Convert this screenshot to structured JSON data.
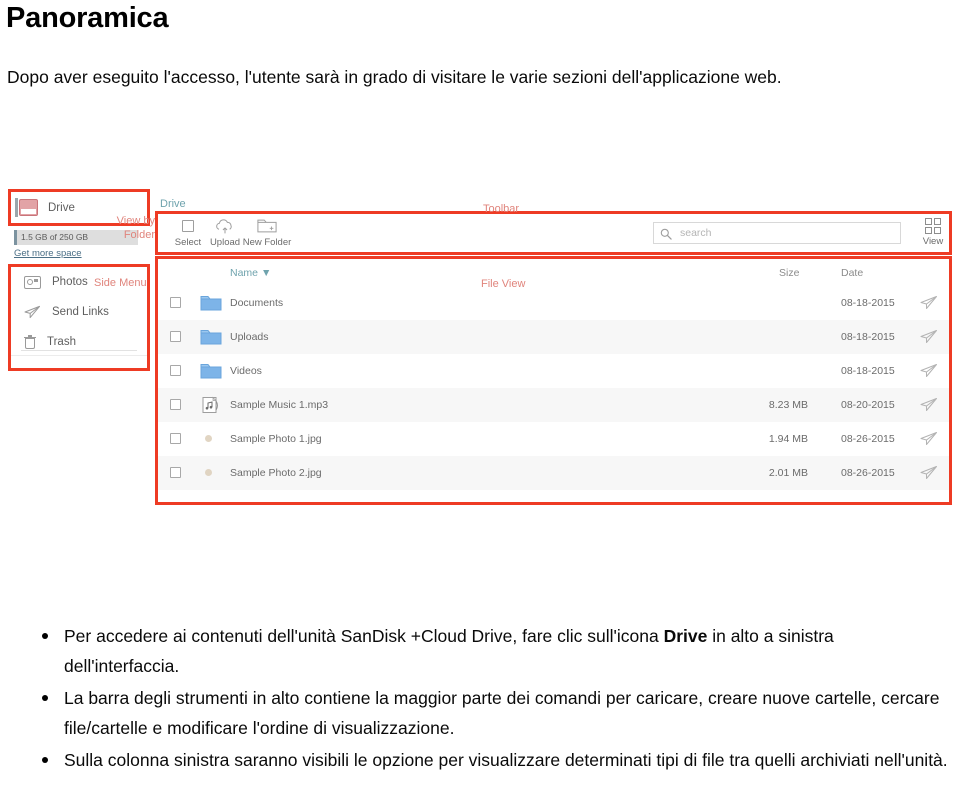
{
  "document": {
    "title": "Panoramica",
    "intro": "Dopo aver eseguito l'accesso, l'utente sarà in grado di visitare le varie sezioni dell'applicazione web.",
    "bullets": [
      {
        "pre": "Per accedere ai contenuti dell'unità SanDisk +Cloud Drive, fare clic sull'icona ",
        "bold": "Drive",
        "post": " in alto a sinistra dell'interfaccia."
      },
      {
        "pre": "La barra degli strumenti in alto contiene la maggior parte dei comandi per caricare, creare nuove cartelle, cercare file/cartelle e modificare l'ordine di visualizzazione.",
        "bold": "",
        "post": ""
      },
      {
        "pre": "Sulla colonna sinistra saranno visibili le opzione per visualizzare determinati tipi di file tra quelli archiviati nell'unità.",
        "bold": "",
        "post": ""
      }
    ]
  },
  "annotations": {
    "view_by_folder": "View by\nFolder",
    "view_by_folder_l1": "View by",
    "view_by_folder_l2": "Folder",
    "side_menu": "Side Menu",
    "toolbar": "Toolbar",
    "file_view": "File View",
    "box_color": "#ee3b24",
    "label_color": "#e0847c"
  },
  "app": {
    "sidebar": {
      "drive": {
        "label": "Drive",
        "icon": "drive-icon"
      },
      "storage": {
        "text": "1.5 GB of 250 GB",
        "used_gb": 1.5,
        "total_gb": 250,
        "percent": 0.6
      },
      "get_more_space": "Get more space",
      "menu_items": [
        {
          "label": "Photos",
          "icon": "camera-icon"
        },
        {
          "label": "Send Links",
          "icon": "paper-plane-icon"
        },
        {
          "label": "Trash",
          "icon": "trash-icon"
        }
      ]
    },
    "breadcrumb": "Drive",
    "toolbar": {
      "buttons": [
        {
          "label": "Select",
          "icon": "checkbox-icon"
        },
        {
          "label": "Upload",
          "icon": "cloud-upload-icon"
        },
        {
          "label": "New Folder",
          "icon": "new-folder-icon"
        }
      ],
      "search": {
        "placeholder": "search",
        "value": "",
        "icon": "search-icon"
      },
      "view": {
        "label": "View",
        "icon": "grid-view-icon"
      }
    },
    "file_view": {
      "columns": {
        "name": "Name",
        "sort_glyph": "▼",
        "size": "Size",
        "date": "Date"
      },
      "rows": [
        {
          "name": "Documents",
          "icon": "folder-icon",
          "size": "",
          "date": "08-18-2015"
        },
        {
          "name": "Uploads",
          "icon": "folder-icon",
          "size": "",
          "date": "08-18-2015"
        },
        {
          "name": "Videos",
          "icon": "folder-icon",
          "size": "",
          "date": "08-18-2015"
        },
        {
          "name": "Sample Music 1.mp3",
          "icon": "music-file-icon",
          "size": "8.23 MB",
          "date": "08-20-2015"
        },
        {
          "name": "Sample Photo 1.jpg",
          "icon": "photo-thumbnail",
          "size": "1.94 MB",
          "date": "08-26-2015"
        },
        {
          "name": "Sample Photo 2.jpg",
          "icon": "photo-thumbnail",
          "size": "2.01 MB",
          "date": "08-26-2015"
        }
      ]
    }
  }
}
